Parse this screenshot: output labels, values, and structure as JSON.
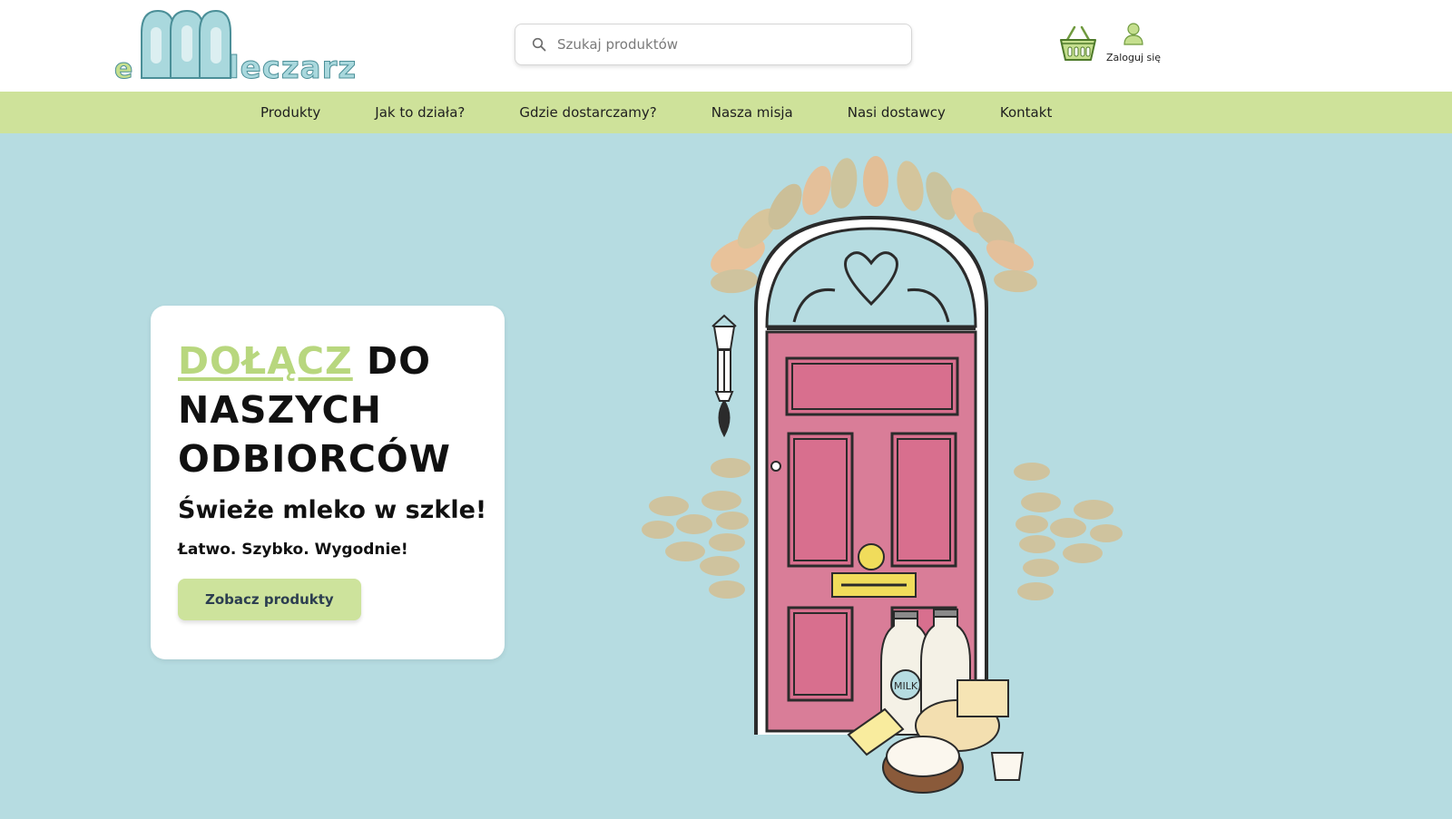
{
  "brand": {
    "logo_text": "eMleczarz"
  },
  "search": {
    "placeholder": "Szukaj produktów"
  },
  "header": {
    "login_label": "Zaloguj się"
  },
  "nav": {
    "items": [
      {
        "label": "Produkty"
      },
      {
        "label": "Jak to działa?"
      },
      {
        "label": "Gdzie dostarczamy?"
      },
      {
        "label": "Nasza misja"
      },
      {
        "label": "Nasi dostawcy"
      },
      {
        "label": "Kontakt"
      }
    ]
  },
  "hero": {
    "title_accent": "Dołącz",
    "title_rest": "do naszych odbiorców",
    "subtitle": "Świeże mleko w szkle!",
    "tagline": "Łatwo. Szybko. Wygodnie!",
    "button_label": "Zobacz produkty"
  },
  "illustration": {
    "bottle_label": "MILK"
  },
  "colors": {
    "accent_green": "#cee29a",
    "title_green": "#b8d77e",
    "background_blue": "#b6dce1",
    "logo_blue": "#a9d8dd",
    "door_pink": "#d9728f"
  }
}
